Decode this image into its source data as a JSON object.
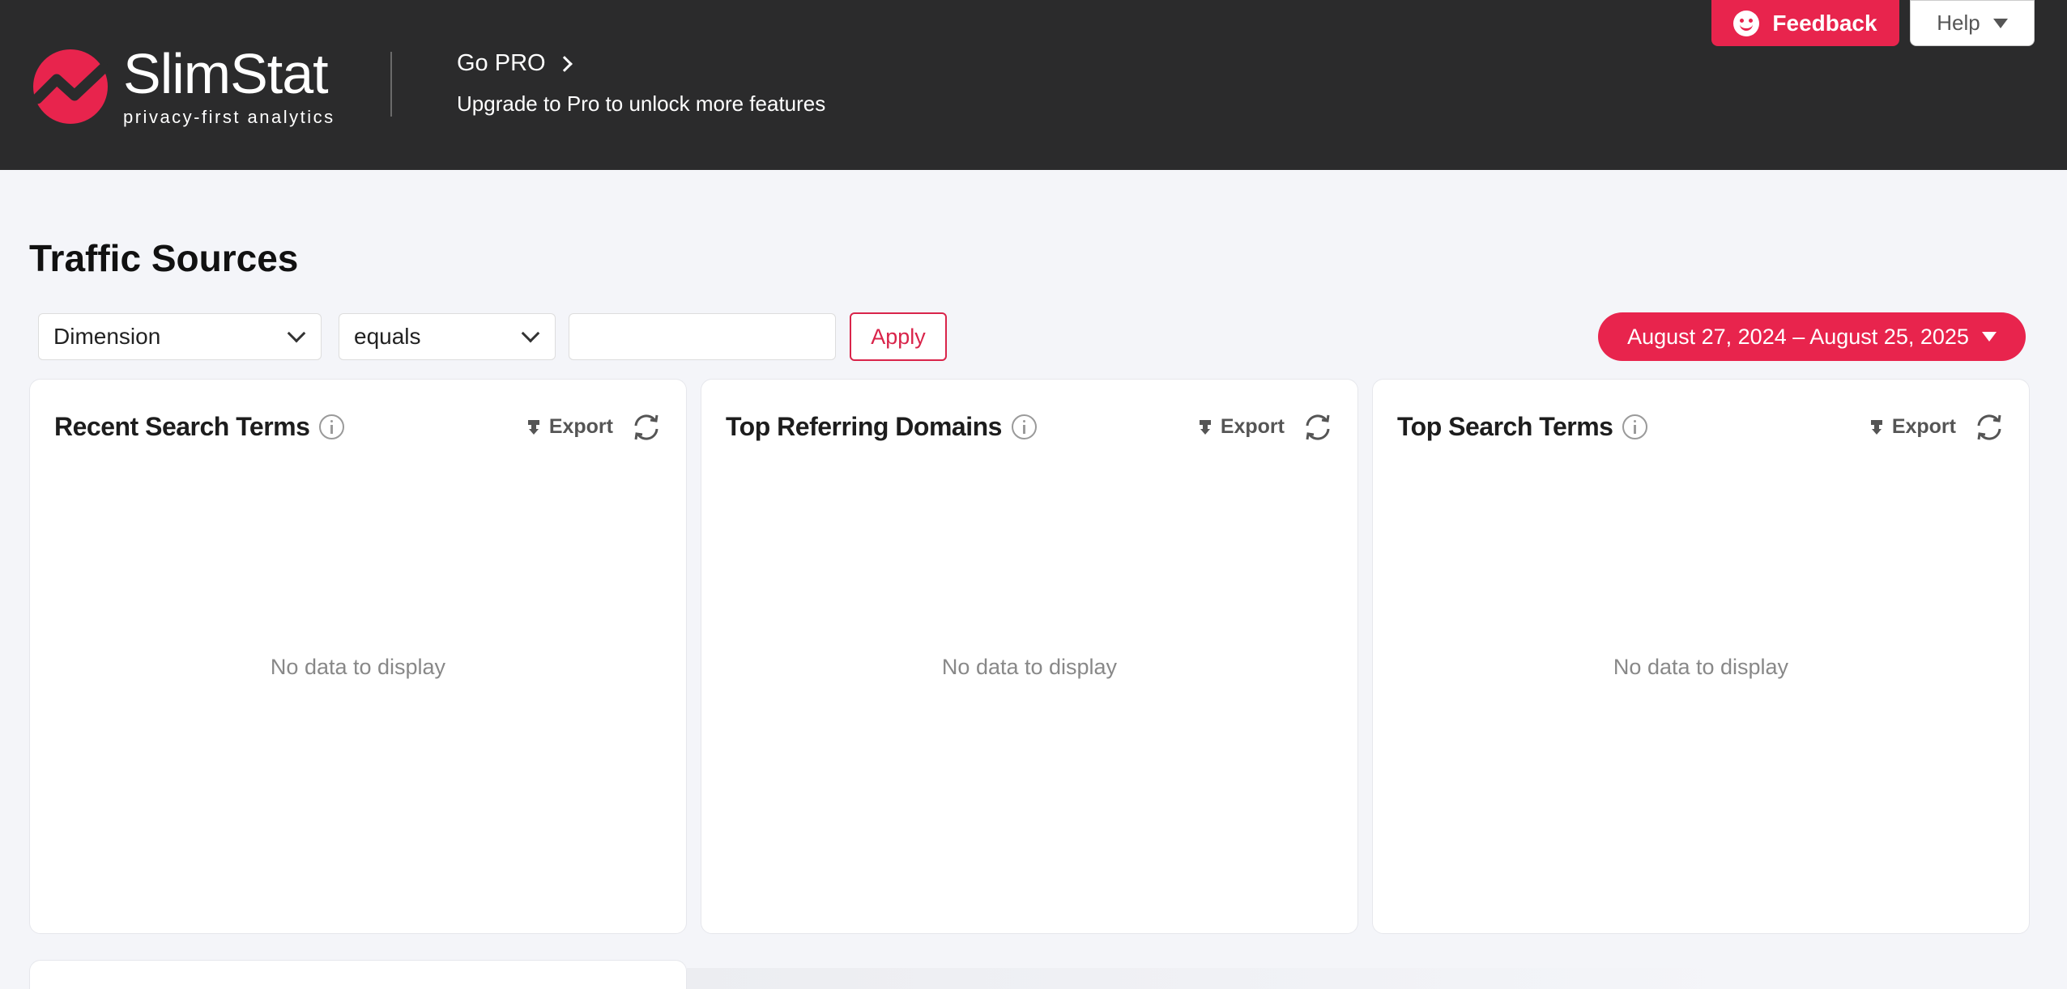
{
  "header": {
    "brand_name": "SlimStat",
    "brand_tagline": "privacy-first analytics",
    "gopro_title": "Go PRO",
    "gopro_subtitle": "Upgrade to Pro to unlock more features",
    "feedback_label": "Feedback",
    "help_label": "Help"
  },
  "page": {
    "title": "Traffic Sources"
  },
  "filters": {
    "dimension_value": "Dimension",
    "operator_value": "equals",
    "value_input": "",
    "apply_label": "Apply",
    "date_range": "August 27, 2024 – August 25, 2025"
  },
  "cards": [
    {
      "title": "Recent Search Terms",
      "export_label": "Export",
      "empty_message": "No data to display"
    },
    {
      "title": "Top Referring Domains",
      "export_label": "Export",
      "empty_message": "No data to display"
    },
    {
      "title": "Top Search Terms",
      "export_label": "Export",
      "empty_message": "No data to display"
    }
  ],
  "colors": {
    "accent": "#e8244d",
    "header_bg": "#2b2b2c",
    "page_bg": "#f4f5f9"
  }
}
